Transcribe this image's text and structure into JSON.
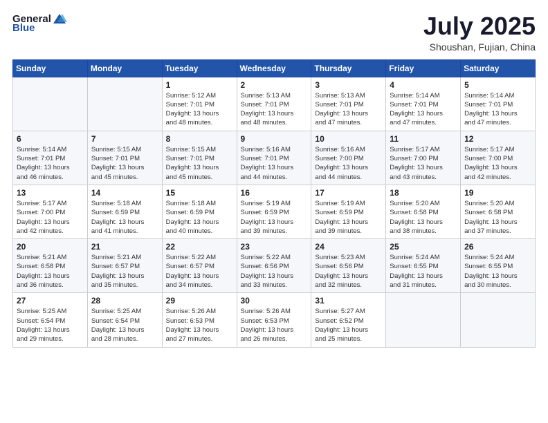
{
  "header": {
    "logo_general": "General",
    "logo_blue": "Blue",
    "title": "July 2025",
    "subtitle": "Shoushan, Fujian, China"
  },
  "days_of_week": [
    "Sunday",
    "Monday",
    "Tuesday",
    "Wednesday",
    "Thursday",
    "Friday",
    "Saturday"
  ],
  "weeks": [
    [
      {
        "num": "",
        "info": ""
      },
      {
        "num": "",
        "info": ""
      },
      {
        "num": "1",
        "info": "Sunrise: 5:12 AM\nSunset: 7:01 PM\nDaylight: 13 hours\nand 48 minutes."
      },
      {
        "num": "2",
        "info": "Sunrise: 5:13 AM\nSunset: 7:01 PM\nDaylight: 13 hours\nand 48 minutes."
      },
      {
        "num": "3",
        "info": "Sunrise: 5:13 AM\nSunset: 7:01 PM\nDaylight: 13 hours\nand 47 minutes."
      },
      {
        "num": "4",
        "info": "Sunrise: 5:14 AM\nSunset: 7:01 PM\nDaylight: 13 hours\nand 47 minutes."
      },
      {
        "num": "5",
        "info": "Sunrise: 5:14 AM\nSunset: 7:01 PM\nDaylight: 13 hours\nand 47 minutes."
      }
    ],
    [
      {
        "num": "6",
        "info": "Sunrise: 5:14 AM\nSunset: 7:01 PM\nDaylight: 13 hours\nand 46 minutes."
      },
      {
        "num": "7",
        "info": "Sunrise: 5:15 AM\nSunset: 7:01 PM\nDaylight: 13 hours\nand 45 minutes."
      },
      {
        "num": "8",
        "info": "Sunrise: 5:15 AM\nSunset: 7:01 PM\nDaylight: 13 hours\nand 45 minutes."
      },
      {
        "num": "9",
        "info": "Sunrise: 5:16 AM\nSunset: 7:01 PM\nDaylight: 13 hours\nand 44 minutes."
      },
      {
        "num": "10",
        "info": "Sunrise: 5:16 AM\nSunset: 7:00 PM\nDaylight: 13 hours\nand 44 minutes."
      },
      {
        "num": "11",
        "info": "Sunrise: 5:17 AM\nSunset: 7:00 PM\nDaylight: 13 hours\nand 43 minutes."
      },
      {
        "num": "12",
        "info": "Sunrise: 5:17 AM\nSunset: 7:00 PM\nDaylight: 13 hours\nand 42 minutes."
      }
    ],
    [
      {
        "num": "13",
        "info": "Sunrise: 5:17 AM\nSunset: 7:00 PM\nDaylight: 13 hours\nand 42 minutes."
      },
      {
        "num": "14",
        "info": "Sunrise: 5:18 AM\nSunset: 6:59 PM\nDaylight: 13 hours\nand 41 minutes."
      },
      {
        "num": "15",
        "info": "Sunrise: 5:18 AM\nSunset: 6:59 PM\nDaylight: 13 hours\nand 40 minutes."
      },
      {
        "num": "16",
        "info": "Sunrise: 5:19 AM\nSunset: 6:59 PM\nDaylight: 13 hours\nand 39 minutes."
      },
      {
        "num": "17",
        "info": "Sunrise: 5:19 AM\nSunset: 6:59 PM\nDaylight: 13 hours\nand 39 minutes."
      },
      {
        "num": "18",
        "info": "Sunrise: 5:20 AM\nSunset: 6:58 PM\nDaylight: 13 hours\nand 38 minutes."
      },
      {
        "num": "19",
        "info": "Sunrise: 5:20 AM\nSunset: 6:58 PM\nDaylight: 13 hours\nand 37 minutes."
      }
    ],
    [
      {
        "num": "20",
        "info": "Sunrise: 5:21 AM\nSunset: 6:58 PM\nDaylight: 13 hours\nand 36 minutes."
      },
      {
        "num": "21",
        "info": "Sunrise: 5:21 AM\nSunset: 6:57 PM\nDaylight: 13 hours\nand 35 minutes."
      },
      {
        "num": "22",
        "info": "Sunrise: 5:22 AM\nSunset: 6:57 PM\nDaylight: 13 hours\nand 34 minutes."
      },
      {
        "num": "23",
        "info": "Sunrise: 5:22 AM\nSunset: 6:56 PM\nDaylight: 13 hours\nand 33 minutes."
      },
      {
        "num": "24",
        "info": "Sunrise: 5:23 AM\nSunset: 6:56 PM\nDaylight: 13 hours\nand 32 minutes."
      },
      {
        "num": "25",
        "info": "Sunrise: 5:24 AM\nSunset: 6:55 PM\nDaylight: 13 hours\nand 31 minutes."
      },
      {
        "num": "26",
        "info": "Sunrise: 5:24 AM\nSunset: 6:55 PM\nDaylight: 13 hours\nand 30 minutes."
      }
    ],
    [
      {
        "num": "27",
        "info": "Sunrise: 5:25 AM\nSunset: 6:54 PM\nDaylight: 13 hours\nand 29 minutes."
      },
      {
        "num": "28",
        "info": "Sunrise: 5:25 AM\nSunset: 6:54 PM\nDaylight: 13 hours\nand 28 minutes."
      },
      {
        "num": "29",
        "info": "Sunrise: 5:26 AM\nSunset: 6:53 PM\nDaylight: 13 hours\nand 27 minutes."
      },
      {
        "num": "30",
        "info": "Sunrise: 5:26 AM\nSunset: 6:53 PM\nDaylight: 13 hours\nand 26 minutes."
      },
      {
        "num": "31",
        "info": "Sunrise: 5:27 AM\nSunset: 6:52 PM\nDaylight: 13 hours\nand 25 minutes."
      },
      {
        "num": "",
        "info": ""
      },
      {
        "num": "",
        "info": ""
      }
    ]
  ]
}
